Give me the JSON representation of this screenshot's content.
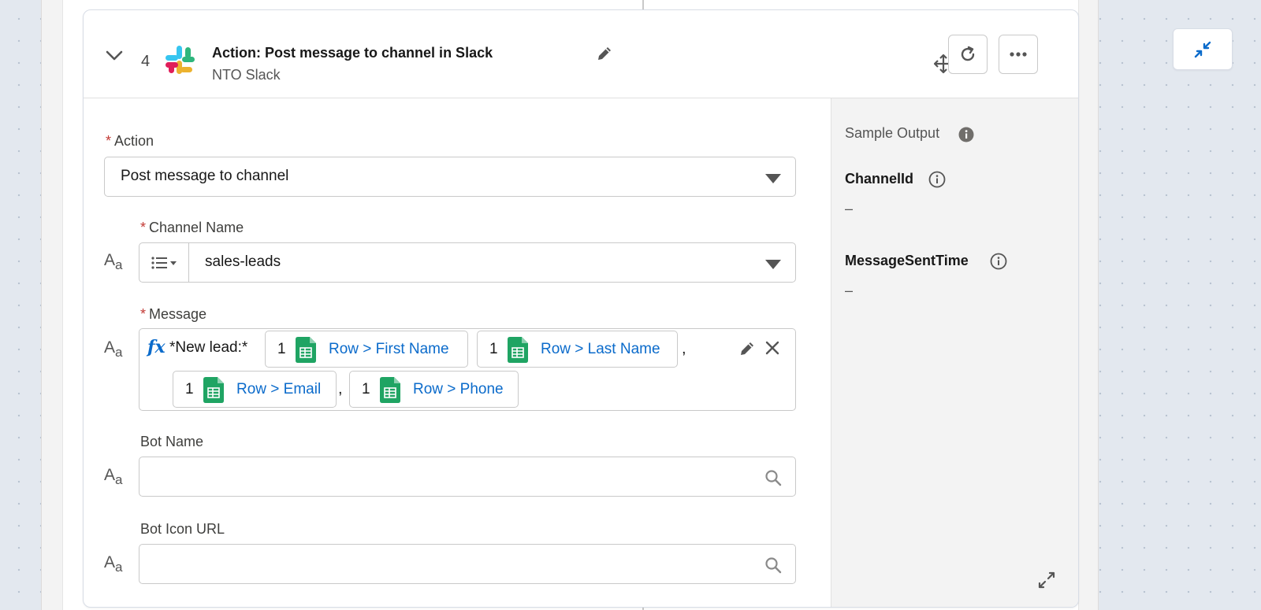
{
  "step": {
    "number": "4",
    "title": "Action: Post message to channel in Slack",
    "connection": "NTO Slack"
  },
  "fields": {
    "action": {
      "label": "Action",
      "value": "Post message to channel"
    },
    "channel": {
      "label": "Channel Name",
      "value": "sales-leads"
    },
    "message": {
      "label": "Message",
      "prefix": "fx",
      "text": "*New lead:*",
      "pills": [
        {
          "number": "1",
          "ref": "Row > First Name"
        },
        {
          "number": "1",
          "ref": "Row > Last Name"
        },
        {
          "number": "1",
          "ref": "Row > Email"
        },
        {
          "number": "1",
          "ref": "Row > Phone"
        }
      ],
      "separator": ","
    },
    "bot_name": {
      "label": "Bot Name",
      "value": ""
    },
    "bot_icon_url": {
      "label": "Bot Icon URL",
      "value": ""
    }
  },
  "sample_output": {
    "label": "Sample Output",
    "outputs": [
      {
        "name": "ChannelId",
        "value": "–"
      },
      {
        "name": "MessageSentTime",
        "value": "–"
      }
    ]
  },
  "type_glyph": {
    "upper": "A",
    "lower": "a"
  },
  "colors": {
    "link": "#0b6bcb",
    "required": "#c23934",
    "sheets_green": "#1fa463",
    "slack_blue": "#36c5f0",
    "slack_green": "#2eb67d",
    "slack_yellow": "#ecb22e",
    "slack_red": "#e01e5a"
  }
}
